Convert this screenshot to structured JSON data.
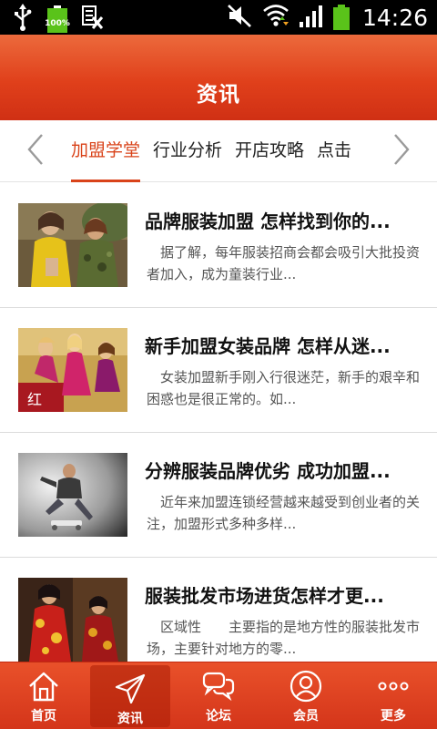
{
  "status_bar": {
    "icons": [
      "usb-icon",
      "battery-charging-icon",
      "keyboard-icon",
      "mute-icon",
      "wifi-icon",
      "signal-icon",
      "battery-icon"
    ],
    "battery_small_label": "100%",
    "time": "14:26"
  },
  "header": {
    "title": "资讯"
  },
  "tabs": {
    "items": [
      {
        "label": "加盟学堂",
        "active": true
      },
      {
        "label": "行业分析",
        "active": false
      },
      {
        "label": "开店攻略",
        "active": false
      },
      {
        "label": "点击",
        "active": false
      }
    ]
  },
  "articles": [
    {
      "title": "品牌服装加盟 怎样找到你的...",
      "summary": "据了解，每年服装招商会都会吸引大批投资者加入，成为童装行业..."
    },
    {
      "title": "新手加盟女装品牌 怎样从迷...",
      "summary": "女装加盟新手刚入行很迷茫，新手的艰辛和困惑也是很正常的。如..."
    },
    {
      "title": "分辨服装品牌优劣 成功加盟...",
      "summary": "近年来加盟连锁经营越来越受到创业者的关注，加盟形式多种多样..."
    },
    {
      "title": "服装批发市场进货怎样才更...",
      "summary": "区域性　　主要指的是地方性的服装批发市场，主要针对地方的零..."
    }
  ],
  "bottom_nav": {
    "items": [
      {
        "label": "首页",
        "icon": "home-icon",
        "active": false
      },
      {
        "label": "资讯",
        "icon": "paper-plane-icon",
        "active": true
      },
      {
        "label": "论坛",
        "icon": "chat-bubbles-icon",
        "active": false
      },
      {
        "label": "会员",
        "icon": "user-icon",
        "active": false
      },
      {
        "label": "更多",
        "icon": "more-dots-icon",
        "active": false
      }
    ]
  }
}
